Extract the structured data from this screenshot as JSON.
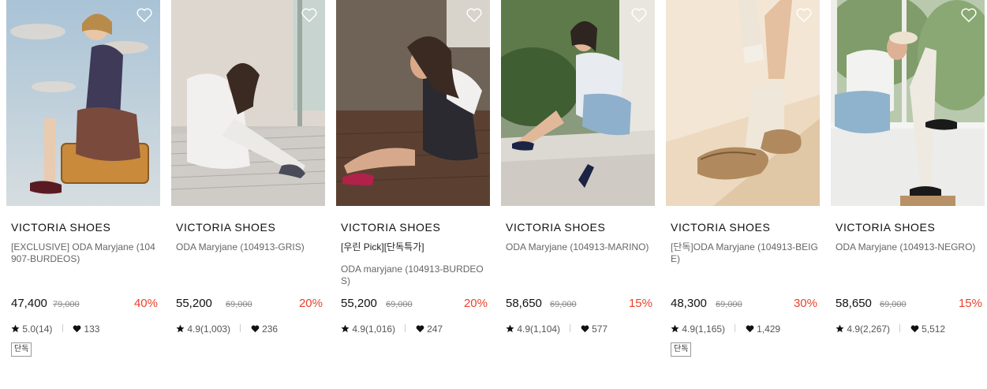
{
  "colors": {
    "discount": "#e8412b",
    "text_muted": "#666666",
    "brand": "#111111"
  },
  "icons": {
    "wishlist": "heart-outline-icon",
    "rating": "star-icon",
    "likes": "heart-filled-icon"
  },
  "products": [
    {
      "brand": "VICTORIA SHOES",
      "name": "[EXCLUSIVE] ODA Maryjane (104907-BURDEOS)",
      "subname": "",
      "price": "47,400",
      "original_price": "79,000",
      "discount": "40%",
      "rating": "5.0(14)",
      "likes": "133",
      "tag": "단독"
    },
    {
      "brand": "VICTORIA SHOES",
      "name": "ODA Maryjane (104913-GRIS)",
      "subname": "",
      "price": "55,200",
      "original_price": "69,000",
      "discount": "20%",
      "rating": "4.9(1,003)",
      "likes": "236",
      "tag": ""
    },
    {
      "brand": "VICTORIA SHOES",
      "name": "[우린 Pick][단독특가]",
      "subname": "ODA maryjane (104913-BURDEOS)",
      "price": "55,200",
      "original_price": "69,000",
      "discount": "20%",
      "rating": "4.9(1,016)",
      "likes": "247",
      "tag": ""
    },
    {
      "brand": "VICTORIA SHOES",
      "name": "ODA Maryjane (104913-MARINO)",
      "subname": "",
      "price": "58,650",
      "original_price": "69,000",
      "discount": "15%",
      "rating": "4.9(1,104)",
      "likes": "577",
      "tag": ""
    },
    {
      "brand": "VICTORIA SHOES",
      "name": "[단독]ODA Maryjane (104913-BEIGE)",
      "subname": "",
      "price": "48,300",
      "original_price": "69,000",
      "discount": "30%",
      "rating": "4.9(1,165)",
      "likes": "1,429",
      "tag": "단독"
    },
    {
      "brand": "VICTORIA SHOES",
      "name": "ODA Maryjane (104913-NEGRO)",
      "subname": "",
      "price": "58,650",
      "original_price": "69,000",
      "discount": "15%",
      "rating": "4.9(2,267)",
      "likes": "5,512",
      "tag": ""
    }
  ]
}
